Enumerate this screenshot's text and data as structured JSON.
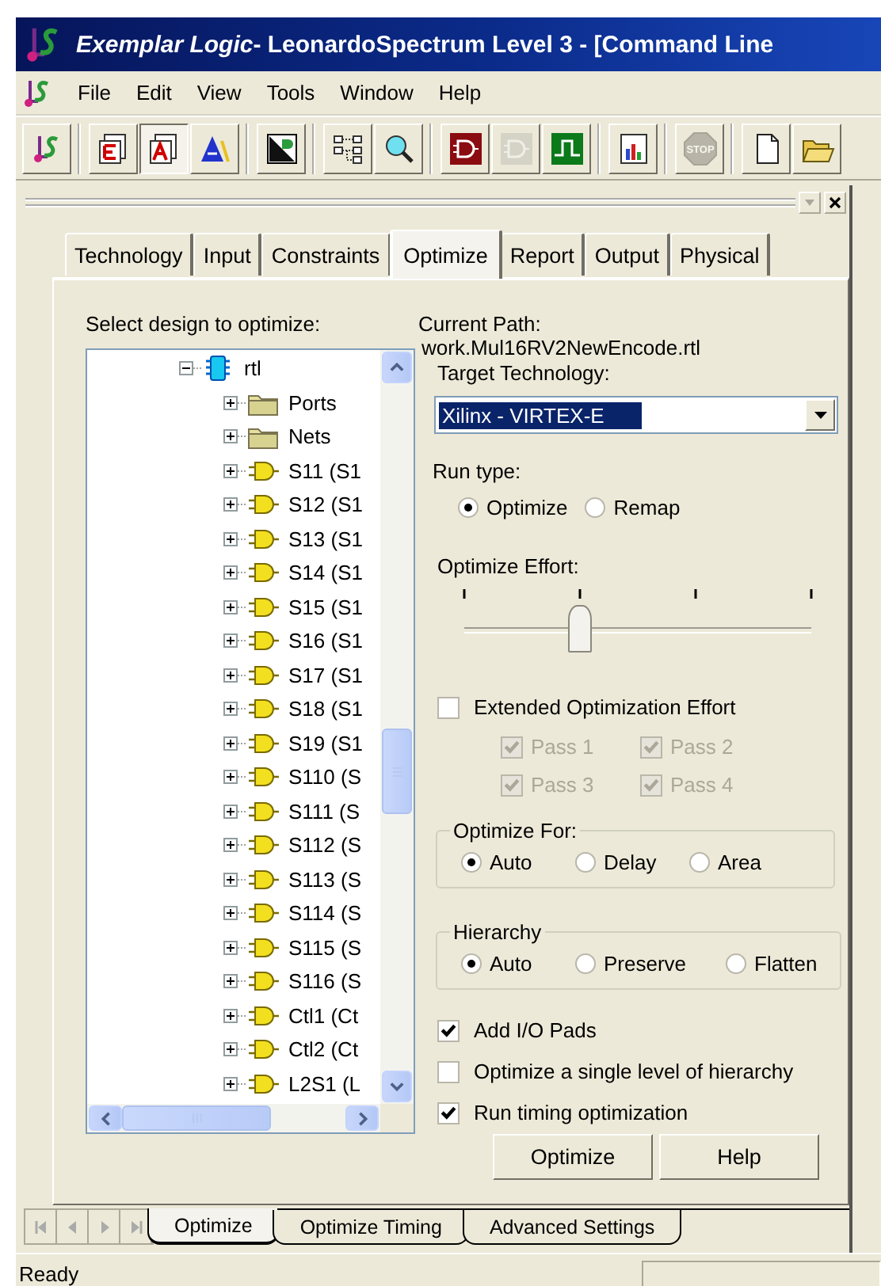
{
  "window": {
    "title": "*Exemplar Logic*- LeonardoSpectrum Level 3 - [Command Line"
  },
  "menu": [
    "File",
    "Edit",
    "View",
    "Tools",
    "Window",
    "Help"
  ],
  "toolbar": [
    [
      {
        "pressed": false,
        "disabled": false
      }
    ],
    [
      {
        "pressed": false,
        "disabled": false
      },
      {
        "pressed": true,
        "disabled": false
      },
      {
        "pressed": false,
        "disabled": false
      }
    ],
    [
      {
        "pressed": false,
        "disabled": false
      }
    ],
    [
      {
        "pressed": false,
        "disabled": false
      },
      {
        "pressed": false,
        "disabled": false
      }
    ],
    [
      {
        "pressed": false,
        "disabled": false
      },
      {
        "pressed": false,
        "disabled": true
      },
      {
        "pressed": false,
        "disabled": false
      }
    ],
    [
      {
        "pressed": false,
        "disabled": false
      }
    ],
    [
      {
        "pressed": false,
        "disabled": true,
        "label": "STOP"
      }
    ],
    [
      {
        "pressed": false,
        "disabled": false
      },
      {
        "pressed": false,
        "disabled": false
      }
    ]
  ],
  "tabs": [
    {
      "label": "Technology",
      "selected": false
    },
    {
      "label": "Input",
      "selected": false
    },
    {
      "label": "Constraints",
      "selected": false
    },
    {
      "label": "Optimize",
      "selected": true
    },
    {
      "label": "Report",
      "selected": false
    },
    {
      "label": "Output",
      "selected": false
    },
    {
      "label": "Physical",
      "selected": false
    }
  ],
  "design": {
    "label": "Select design to optimize:",
    "tree": [
      {
        "label": "rtl",
        "kind": "module",
        "expanded": true,
        "children": [
          {
            "label": "Ports",
            "kind": "folder",
            "expanded": false
          },
          {
            "label": "Nets",
            "kind": "folder",
            "expanded": false
          },
          {
            "label": "S11 (S1",
            "kind": "instance",
            "expanded": false
          },
          {
            "label": "S12 (S1",
            "kind": "instance",
            "expanded": false
          },
          {
            "label": "S13 (S1",
            "kind": "instance",
            "expanded": false
          },
          {
            "label": "S14 (S1",
            "kind": "instance",
            "expanded": false
          },
          {
            "label": "S15 (S1",
            "kind": "instance",
            "expanded": false
          },
          {
            "label": "S16 (S1",
            "kind": "instance",
            "expanded": false
          },
          {
            "label": "S17 (S1",
            "kind": "instance",
            "expanded": false
          },
          {
            "label": "S18 (S1",
            "kind": "instance",
            "expanded": false
          },
          {
            "label": "S19 (S1",
            "kind": "instance",
            "expanded": false
          },
          {
            "label": "S110 (S",
            "kind": "instance",
            "expanded": false
          },
          {
            "label": "S111 (S",
            "kind": "instance",
            "expanded": false
          },
          {
            "label": "S112 (S",
            "kind": "instance",
            "expanded": false
          },
          {
            "label": "S113 (S",
            "kind": "instance",
            "expanded": false
          },
          {
            "label": "S114 (S",
            "kind": "instance",
            "expanded": false
          },
          {
            "label": "S115 (S",
            "kind": "instance",
            "expanded": false
          },
          {
            "label": "S116 (S",
            "kind": "instance",
            "expanded": false
          },
          {
            "label": "Ctl1 (Ct",
            "kind": "instance",
            "expanded": false
          },
          {
            "label": "Ctl2 (Ct",
            "kind": "instance",
            "expanded": false
          },
          {
            "label": "L2S1 (L",
            "kind": "instance",
            "expanded": false
          }
        ]
      }
    ]
  },
  "current_path": {
    "label": "Current Path:",
    "value": "work.Mul16RV2NewEncode.rtl"
  },
  "target_technology": {
    "label": "Target Technology:",
    "value": "Xilinx - VIRTEX-E"
  },
  "run_type": {
    "label": "Run type:",
    "options": [
      {
        "label": "Optimize",
        "selected": true
      },
      {
        "label": "Remap",
        "selected": false
      }
    ]
  },
  "optimize_effort": {
    "label": "Optimize Effort:",
    "level": 0.333
  },
  "extended_effort": {
    "label": "Extended Optimization Effort",
    "checked": false
  },
  "passes": [
    {
      "label": "Pass 1",
      "checked": true,
      "disabled": true
    },
    {
      "label": "Pass 2",
      "checked": true,
      "disabled": true
    },
    {
      "label": "Pass 3",
      "checked": true,
      "disabled": true
    },
    {
      "label": "Pass 4",
      "checked": true,
      "disabled": true
    }
  ],
  "optimize_for": {
    "title": "Optimize For:",
    "options": [
      {
        "label": "Auto",
        "selected": true
      },
      {
        "label": "Delay",
        "selected": false
      },
      {
        "label": "Area",
        "selected": false
      }
    ]
  },
  "hierarchy": {
    "title": "Hierarchy",
    "options": [
      {
        "label": "Auto",
        "selected": true
      },
      {
        "label": "Preserve",
        "selected": false
      },
      {
        "label": "Flatten",
        "selected": false
      }
    ]
  },
  "options": [
    {
      "label": "Add I/O Pads",
      "checked": true
    },
    {
      "label": "Optimize a single level of hierarchy",
      "checked": false
    },
    {
      "label": "Run timing optimization",
      "checked": true
    }
  ],
  "buttons": [
    "Optimize",
    "Help"
  ],
  "sheet_tabs": [
    {
      "label": "Optimize",
      "selected": true
    },
    {
      "label": "Optimize Timing",
      "selected": false
    },
    {
      "label": "Advanced Settings",
      "selected": false
    }
  ],
  "status_bar": {
    "text": "Ready"
  }
}
